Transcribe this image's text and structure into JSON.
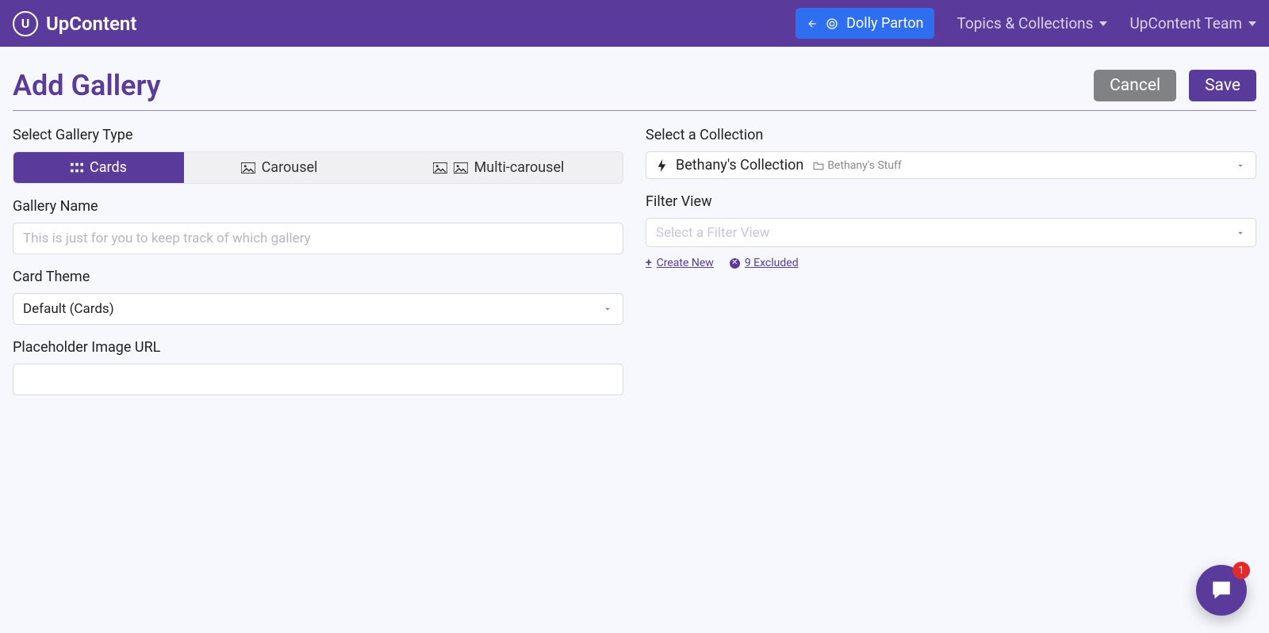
{
  "header": {
    "brand": "UpContent",
    "user_name": "Dolly Parton",
    "nav_topics": "Topics & Collections",
    "nav_team": "UpContent Team"
  },
  "page": {
    "title": "Add Gallery",
    "cancel": "Cancel",
    "save": "Save"
  },
  "left": {
    "select_type_label": "Select Gallery Type",
    "tabs": {
      "cards": "Cards",
      "carousel": "Carousel",
      "multi": "Multi-carousel"
    },
    "gallery_name_label": "Gallery Name",
    "gallery_name_placeholder": "This is just for you to keep track of which gallery",
    "card_theme_label": "Card Theme",
    "card_theme_value": "Default (Cards)",
    "placeholder_url_label": "Placeholder Image URL"
  },
  "right": {
    "select_collection_label": "Select a Collection",
    "collection_name": "Bethany's Collection",
    "collection_folder": "Bethany's Stuff",
    "filter_view_label": "Filter View",
    "filter_view_placeholder": "Select a Filter View",
    "create_new": " Create New",
    "excluded": "9 Excluded"
  },
  "chat": {
    "badge": "1"
  }
}
